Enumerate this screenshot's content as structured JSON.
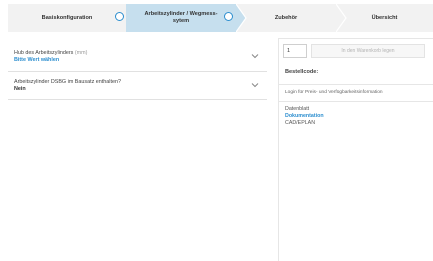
{
  "stepper": {
    "steps": [
      {
        "label": "Basiskonfiguration"
      },
      {
        "label_line1": "Arbeitszylinder / Wegmess-",
        "label_line2": "sytem"
      },
      {
        "label": "Zubehör"
      },
      {
        "label": "Übersicht"
      }
    ],
    "active_step": 2,
    "colors": {
      "active_bg": "#c6dfee",
      "inactive_bg": "#f2f2f2",
      "accent": "#2c8ecf"
    }
  },
  "accordion": {
    "items": [
      {
        "title": "Hub des Arbeitszylinders",
        "unit": "(mm)",
        "value": "Bitte Wert wählen",
        "value_style": "link",
        "icon": "chevron-down-icon"
      },
      {
        "title": "Arbeitszylinder DSBG im Bausatz enthalten?",
        "unit": "",
        "value": "Nein",
        "value_style": "plain",
        "icon": "chevron-down-icon"
      }
    ]
  },
  "order_panel": {
    "quantity": "1",
    "add_to_cart_label": "In den Warenkorb legen",
    "order_code_label": "Bestellcode:",
    "login_text": "Login für Preis- und Verfügbarkeitsinformation",
    "documents": [
      {
        "label": "Datenblatt",
        "style": "plain"
      },
      {
        "label": "Dokumentation",
        "style": "link"
      },
      {
        "label": "CAD/EPLAN",
        "style": "plain"
      }
    ]
  }
}
